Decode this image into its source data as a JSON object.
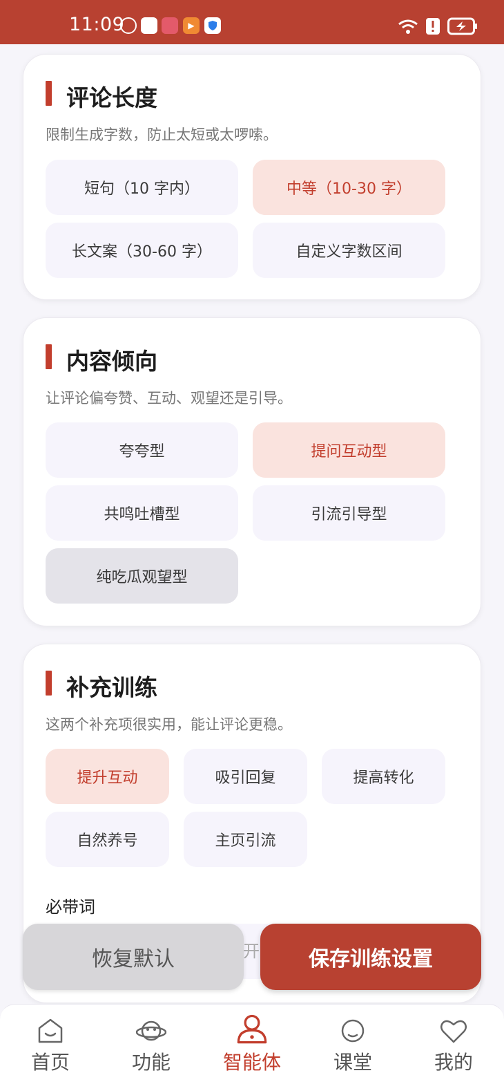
{
  "status_bar": {
    "time": "11:09",
    "accent_color": "#b84131"
  },
  "sections": {
    "length": {
      "title": "评论长度",
      "desc": "限制生成字数，防止太短或太啰嗦。",
      "options": [
        "短句（10 字内）",
        "中等（10-30 字）",
        "长文案（30-60 字）",
        "自定义字数区间"
      ],
      "selected": "中等（10-30 字）"
    },
    "tendency": {
      "title": "内容倾向",
      "desc": "让评论偏夸赞、互动、观望还是引导。",
      "options": [
        "夸夸型",
        "提问互动型",
        "共鸣吐槽型",
        "引流引导型",
        "纯吃瓜观望型"
      ],
      "selected": "提问互动型"
    },
    "extra": {
      "title": "补充训练",
      "desc": "这两个补充项很实用，能让评论更稳。",
      "options": [
        "提升互动",
        "吸引回复",
        "提高转化",
        "自然养号",
        "主页引流"
      ],
      "selected": "提升互动",
      "keyword_label": "必带词",
      "keyword_visible_text": "开"
    }
  },
  "actions": {
    "reset_label": "恢复默认",
    "save_label": "保存训练设置"
  },
  "tabs": [
    {
      "label": "首页",
      "icon": "home-icon"
    },
    {
      "label": "功能",
      "icon": "planet-icon"
    },
    {
      "label": "智能体",
      "icon": "agent-icon",
      "active": true
    },
    {
      "label": "课堂",
      "icon": "classroom-icon"
    },
    {
      "label": "我的",
      "icon": "heart-icon"
    }
  ],
  "colors": {
    "accent": "#c23e2d",
    "selected_bg": "#fae3de",
    "option_bg": "#f6f4fc"
  }
}
